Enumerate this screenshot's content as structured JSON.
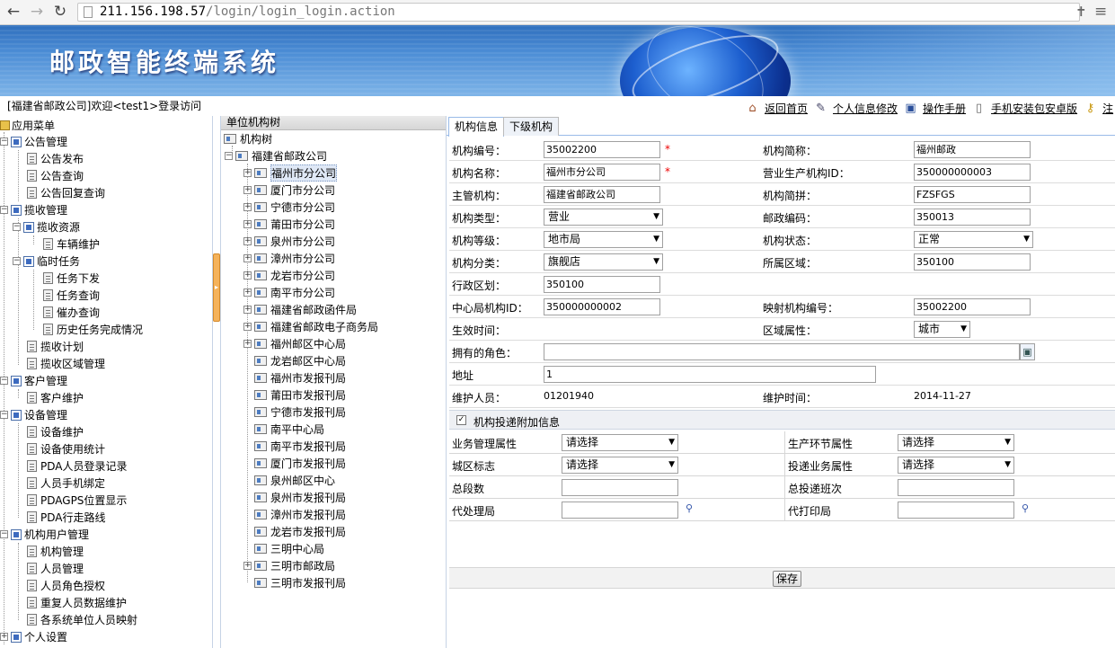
{
  "browser": {
    "url_host": "211.156.198.57",
    "url_path": "/login/login_login.action"
  },
  "banner": {
    "title": "邮政智能终端系统"
  },
  "status": {
    "welcome": "[福建省邮政公司]欢迎<test1>登录访问",
    "links": [
      "返回首页",
      "个人信息修改",
      "操作手册",
      "手机安装包安卓版",
      "注"
    ]
  },
  "menu": {
    "title": "应用菜单",
    "groups": [
      {
        "label": "公告管理",
        "items": [
          "公告发布",
          "公告查询",
          "公告回复查询"
        ]
      },
      {
        "label": "揽收管理",
        "subgroups": [
          {
            "label": "揽收资源",
            "items": [
              "车辆维护"
            ]
          },
          {
            "label": "临时任务",
            "items": [
              "任务下发",
              "任务查询",
              "催办查询",
              "历史任务完成情况"
            ]
          }
        ],
        "items": [
          "揽收计划",
          "揽收区域管理"
        ]
      },
      {
        "label": "客户管理",
        "items": [
          "客户维护"
        ]
      },
      {
        "label": "设备管理",
        "items": [
          "设备维护",
          "设备使用统计",
          "PDA人员登录记录",
          "人员手机绑定",
          "PDAGPS位置显示",
          "PDA行走路线"
        ]
      },
      {
        "label": "机构用户管理",
        "items": [
          "机构管理",
          "人员管理",
          "人员角色授权",
          "重复人员数据维护",
          "各系统单位人员映射"
        ]
      },
      {
        "label": "个人设置",
        "items": []
      }
    ]
  },
  "org_tree": {
    "header": "单位机构树",
    "root": "机构树",
    "company": "福建省邮政公司",
    "nodes": [
      {
        "label": "福州市分公司",
        "expandable": true
      },
      {
        "label": "厦门市分公司",
        "expandable": true
      },
      {
        "label": "宁德市分公司",
        "expandable": true
      },
      {
        "label": "莆田市分公司",
        "expandable": true
      },
      {
        "label": "泉州市分公司",
        "expandable": true
      },
      {
        "label": "漳州市分公司",
        "expandable": true
      },
      {
        "label": "龙岩市分公司",
        "expandable": true
      },
      {
        "label": "南平市分公司",
        "expandable": true
      },
      {
        "label": "福建省邮政函件局",
        "expandable": true
      },
      {
        "label": "福建省邮政电子商务局",
        "expandable": true
      },
      {
        "label": "福州邮区中心局",
        "expandable": true
      },
      {
        "label": "龙岩邮区中心局",
        "expandable": false
      },
      {
        "label": "福州市发报刊局",
        "expandable": false
      },
      {
        "label": "莆田市发报刊局",
        "expandable": false
      },
      {
        "label": "宁德市发报刊局",
        "expandable": false
      },
      {
        "label": "南平中心局",
        "expandable": false
      },
      {
        "label": "南平市发报刊局",
        "expandable": false
      },
      {
        "label": "厦门市发报刊局",
        "expandable": false
      },
      {
        "label": "泉州邮区中心",
        "expandable": false
      },
      {
        "label": "泉州市发报刊局",
        "expandable": false
      },
      {
        "label": "漳州市发报刊局",
        "expandable": false
      },
      {
        "label": "龙岩市发报刊局",
        "expandable": false
      },
      {
        "label": "三明中心局",
        "expandable": false
      },
      {
        "label": "三明市邮政局",
        "expandable": true
      },
      {
        "label": "三明市发报刊局",
        "expandable": false
      }
    ]
  },
  "tabs": [
    "机构信息",
    "下级机构"
  ],
  "form": {
    "org_code_label": "机构编号：",
    "org_code": "35002200",
    "short_name_label": "机构简称：",
    "short_name": "福州邮政",
    "org_name_label": "机构名称：",
    "org_name": "福州市分公司",
    "biz_org_id_label": "营业生产机构ID：",
    "biz_org_id": "350000000003",
    "parent_label": "主管机构：",
    "parent": "福建省邮政公司",
    "pinyin_label": "机构简拼：",
    "pinyin": "FZSFGS",
    "type_label": "机构类型：",
    "type": "营业",
    "postcode_label": "邮政编码：",
    "postcode": "350013",
    "level_label": "机构等级：",
    "level": "地市局",
    "status_label": "机构状态：",
    "status": "正常",
    "category_label": "机构分类：",
    "category": "旗舰店",
    "region_label": "所属区域：",
    "region": "350100",
    "admin_label": "行政区划：",
    "admin": "350100",
    "center_id_label": "中心局机构ID：",
    "center_id": "350000000002",
    "map_code_label": "映射机构编号：",
    "map_code": "35002200",
    "effective_label": "生效时间：",
    "area_attr_label": "区域属性：",
    "area_attr": "城市",
    "roles_label": "拥有的角色：",
    "address_label": "地址",
    "address": "1",
    "maintainer_label": "维护人员：",
    "maintainer": "01201940",
    "maint_time_label": "维护时间：",
    "maint_time": "2014-11-27",
    "extra_section": "机构投递附加信息",
    "biz_attr_label": "业务管理属性",
    "biz_attr": "请选择",
    "prod_attr_label": "生产环节属性",
    "prod_attr": "请选择",
    "urban_label": "城区标志",
    "urban": "请选择",
    "delivery_attr_label": "投递业务属性",
    "delivery_attr": "请选择",
    "segments_label": "总段数",
    "shifts_label": "总投递班次",
    "proxy_label": "代处理局",
    "print_label": "代打印局",
    "save_label": "保存"
  }
}
